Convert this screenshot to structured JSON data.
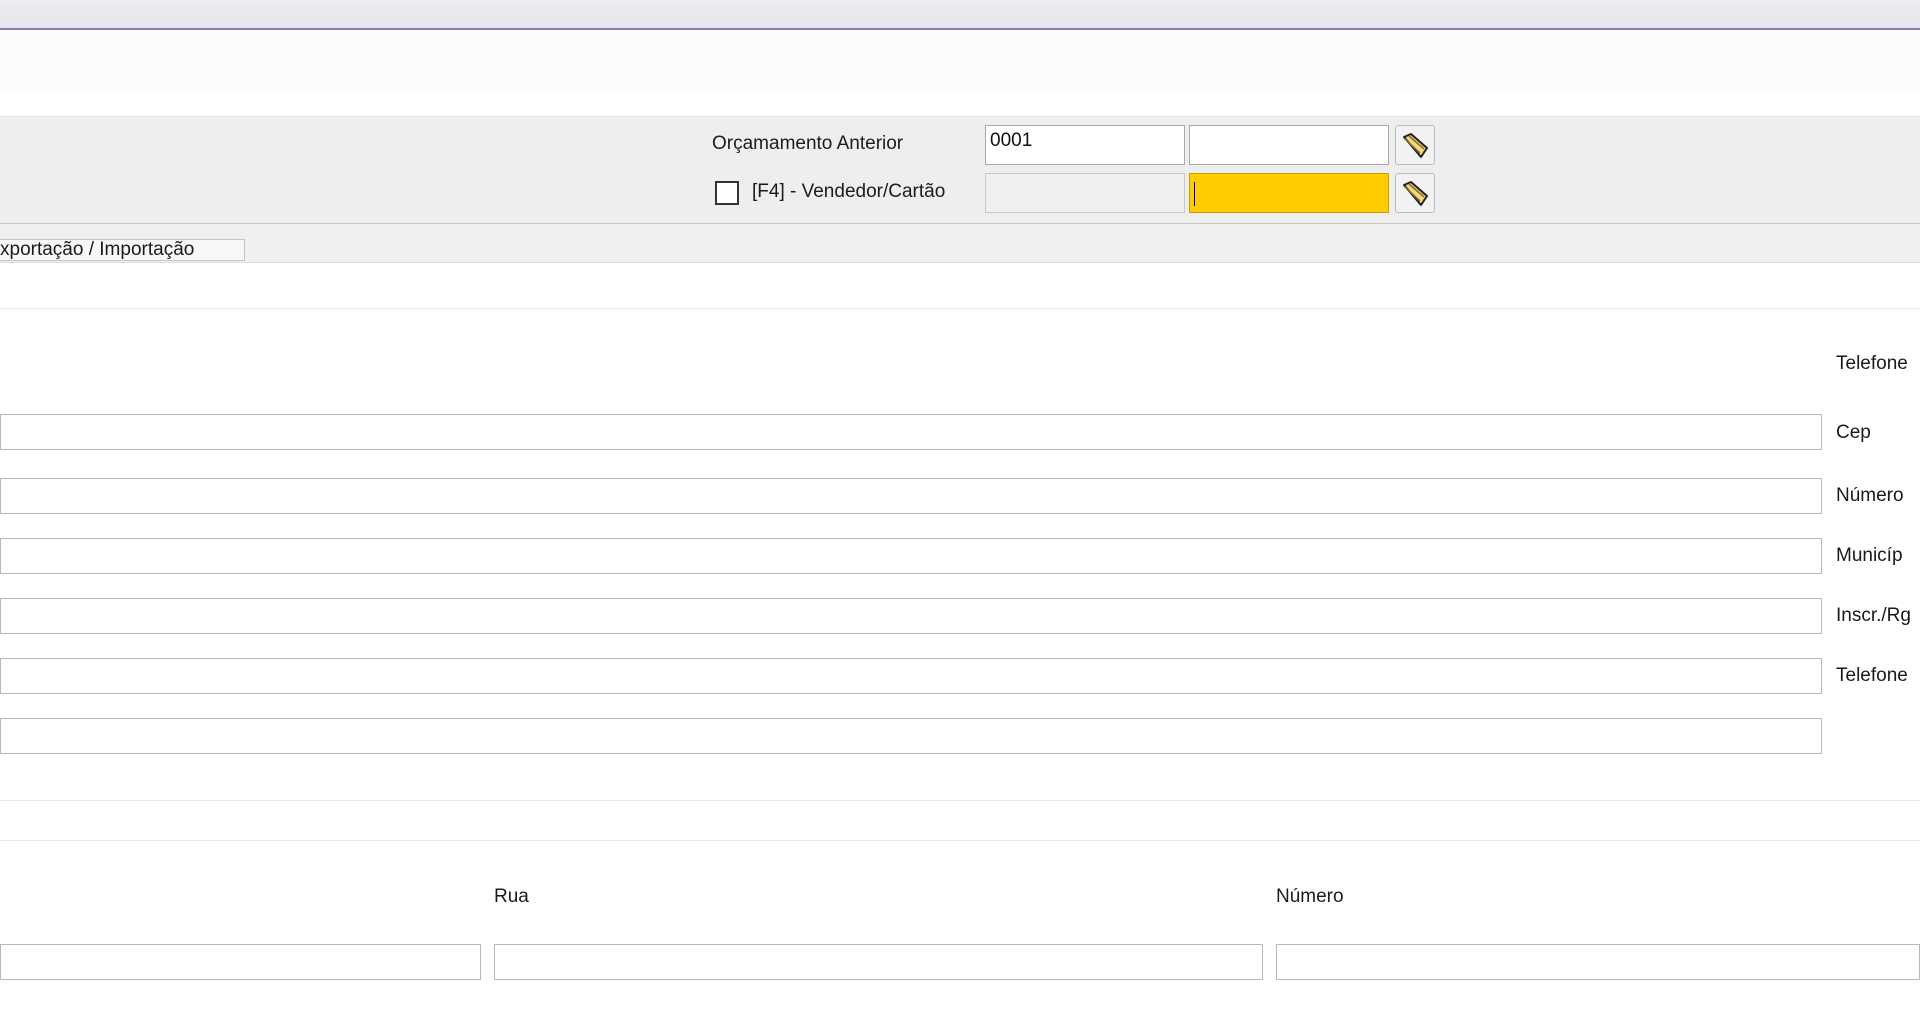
{
  "header": {
    "orcamento_label": "Orçamamento Anterior",
    "orcamento_value": "0001",
    "orcamento_value2": "",
    "vendedor_checkbox_label": "[F4] - Vendedor/Cartão",
    "vendedor_checked": false,
    "vendedor_value": "",
    "vendedor_value2": ""
  },
  "tabs": [
    {
      "label": "xportação / Importação"
    }
  ],
  "customer_form": {
    "right_labels": [
      "Telefone",
      "Cep",
      "Número",
      "Municíp",
      "Inscr./Rg",
      "Telefone"
    ]
  },
  "address_form": {
    "rua_label": "Rua",
    "numero_label": "Número"
  },
  "icons": {
    "lookup": "folder-lookup-icon",
    "checkbox": "checkbox-icon"
  },
  "colors": {
    "active_field": "#ffcc00",
    "title_border": "#7d7fb6"
  }
}
